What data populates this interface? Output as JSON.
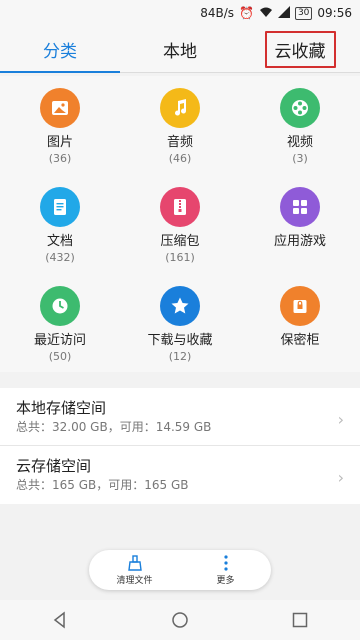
{
  "status_bar": {
    "speed": "84B/s",
    "battery": "30",
    "time": "09:56"
  },
  "tabs": [
    {
      "label": "分类",
      "active": true
    },
    {
      "label": "本地",
      "active": false
    },
    {
      "label": "云收藏",
      "active": false
    }
  ],
  "categories": [
    {
      "label": "图片",
      "count": "(36)",
      "icon": "image-icon",
      "color": "#f0812c"
    },
    {
      "label": "音频",
      "count": "(46)",
      "icon": "music-note-icon",
      "color": "#f4b918"
    },
    {
      "label": "视频",
      "count": "(3)",
      "icon": "film-reel-icon",
      "color": "#3dbb6f"
    },
    {
      "label": "文档",
      "count": "(432)",
      "icon": "document-icon",
      "color": "#21a8e8"
    },
    {
      "label": "压缩包",
      "count": "(161)",
      "icon": "zip-icon",
      "color": "#e6466e"
    },
    {
      "label": "应用游戏",
      "count": "",
      "icon": "apps-grid-icon",
      "color": "#8f5bd8"
    },
    {
      "label": "最近访问",
      "count": "(50)",
      "icon": "clock-icon",
      "color": "#3dbb6f"
    },
    {
      "label": "下载与收藏",
      "count": "(12)",
      "icon": "star-icon",
      "color": "#1a7fdb"
    },
    {
      "label": "保密柜",
      "count": "",
      "icon": "lock-icon",
      "color": "#f0812c"
    }
  ],
  "storage": [
    {
      "title": "本地存储空间",
      "detail": "总共：32.00 GB，可用：14.59 GB"
    },
    {
      "title": "云存储空间",
      "detail": "总共：165 GB，可用：165 GB"
    }
  ],
  "actions": {
    "clean_label": "清理文件",
    "more_label": "更多"
  }
}
